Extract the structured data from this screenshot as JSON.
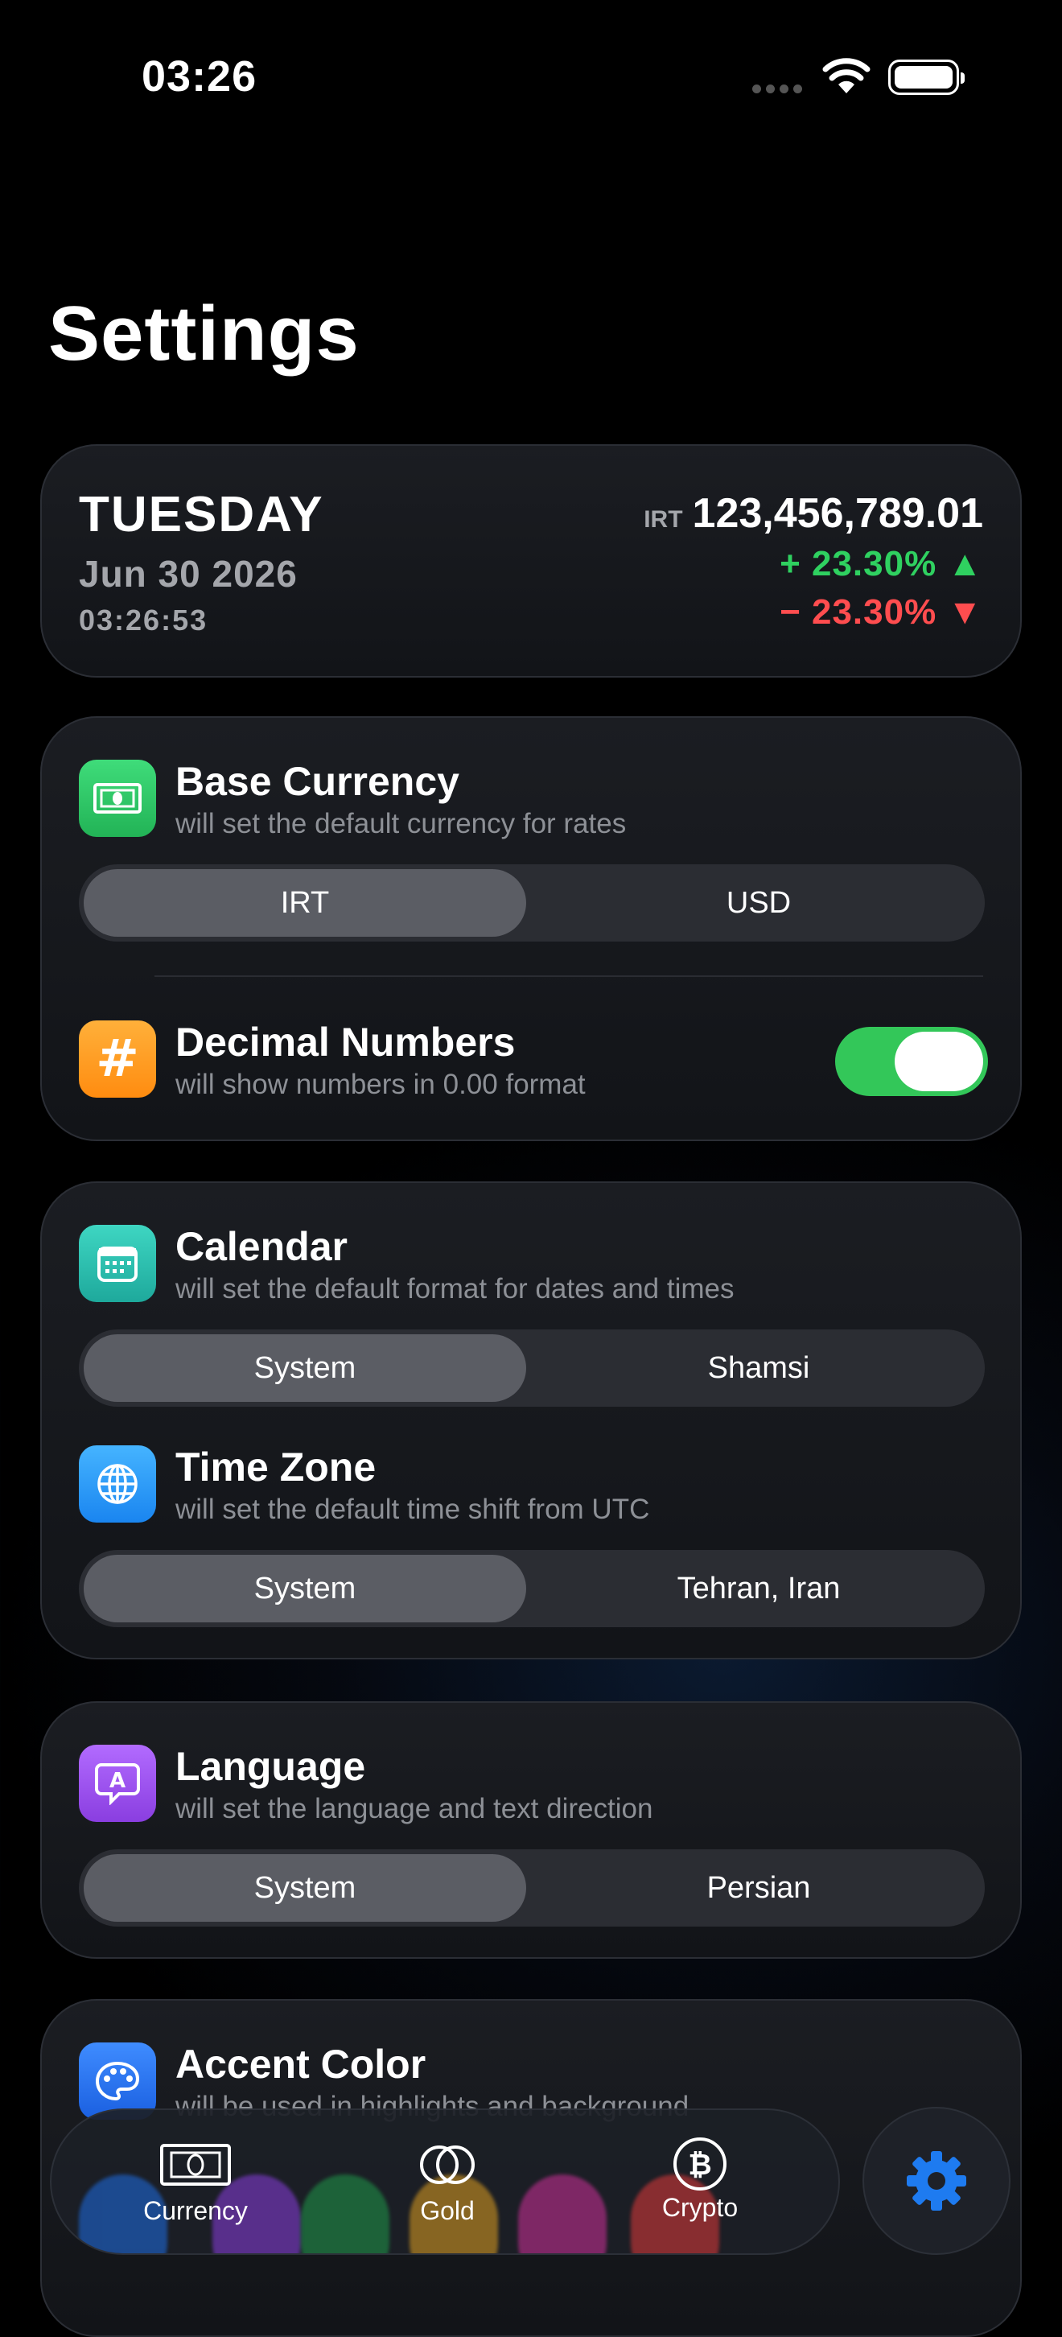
{
  "status": {
    "time": "03:26"
  },
  "title": "Settings",
  "header": {
    "day": "TUESDAY",
    "date": "Jun 30 2026",
    "clock": "03:26:53",
    "currency_code": "IRT",
    "amount": "123,456,789.01",
    "change_up": "+ 23.30% ▲",
    "change_down": "− 23.30% ▼",
    "colors": {
      "up": "#2fd160",
      "down": "#ff4d4f"
    }
  },
  "base_currency": {
    "title": "Base Currency",
    "subtitle": "will set the default currency for rates",
    "options": [
      "IRT",
      "USD"
    ],
    "selected": "IRT",
    "icon": "banknote-icon"
  },
  "decimal_numbers": {
    "title": "Decimal Numbers",
    "subtitle": "will show numbers in 0.00 format",
    "enabled": true,
    "icon": "hash-icon"
  },
  "calendar": {
    "title": "Calendar",
    "subtitle": "will set the default format for dates and times",
    "options": [
      "System",
      "Shamsi"
    ],
    "selected": "System",
    "icon": "calendar-icon"
  },
  "time_zone": {
    "title": "Time Zone",
    "subtitle": "will set the default time shift from UTC",
    "options": [
      "System",
      "Tehran, Iran"
    ],
    "selected": "System",
    "icon": "globe-icon"
  },
  "language": {
    "title": "Language",
    "subtitle": "will set the language and text direction",
    "options": [
      "System",
      "Persian"
    ],
    "selected": "System",
    "icon": "language-icon"
  },
  "accent_color": {
    "title": "Accent Color",
    "subtitle": "will be used in highlights and background",
    "icon": "palette-icon",
    "swatches": [
      "#1e6ee6",
      "#8a3ee0",
      "#1f9a4a",
      "#e0a020",
      "#d0309a",
      "#e23a3a"
    ]
  },
  "tabbar": {
    "tabs": [
      {
        "label": "Currency",
        "icon": "banknote-icon"
      },
      {
        "label": "Gold",
        "icon": "coins-icon"
      },
      {
        "label": "Crypto",
        "icon": "bitcoin-icon"
      }
    ],
    "settings_icon": "gear-icon",
    "accent": "#1e7bf0"
  }
}
